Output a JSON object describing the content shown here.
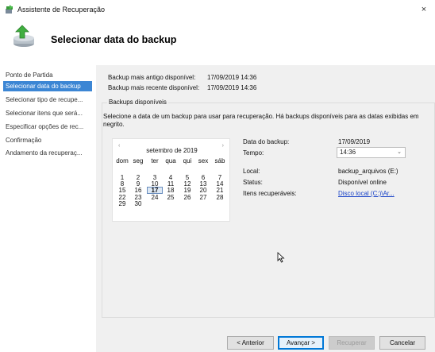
{
  "window": {
    "title": "Assistente de Recuperação",
    "close_glyph": "×"
  },
  "header": {
    "title": "Selecionar data do backup"
  },
  "sidebar": {
    "items": [
      {
        "label": "Ponto de Partida"
      },
      {
        "label": "Selecionar data do backup"
      },
      {
        "label": "Selecionar tipo de recupe..."
      },
      {
        "label": "Selecionar itens que será..."
      },
      {
        "label": "Especificar opções de rec..."
      },
      {
        "label": "Confirmação"
      },
      {
        "label": "Andamento da recuperaç..."
      }
    ],
    "active_index": 1
  },
  "summary": {
    "oldest_label": "Backup mais antigo disponível:",
    "oldest_value": "17/09/2019 14:36",
    "newest_label": "Backup mais recente disponível:",
    "newest_value": "17/09/2019 14:36"
  },
  "available": {
    "legend": "Backups disponíveis",
    "instruction": "Selecione a data de um backup para usar para recuperação. Há backups disponíveis para as datas exibidas em negrito."
  },
  "calendar": {
    "prev_glyph": "‹",
    "next_glyph": "›",
    "month": "setembro de 2019",
    "weekdays": [
      "dom",
      "seg",
      "ter",
      "qua",
      "qui",
      "sex",
      "sáb"
    ],
    "weeks": [
      [
        "1",
        "2",
        "3",
        "4",
        "5",
        "6",
        "7"
      ],
      [
        "8",
        "9",
        "10",
        "11",
        "12",
        "13",
        "14"
      ],
      [
        "15",
        "16",
        "17",
        "18",
        "19",
        "20",
        "21"
      ],
      [
        "22",
        "23",
        "24",
        "25",
        "26",
        "27",
        "28"
      ],
      [
        "29",
        "30",
        "",
        "",
        "",
        "",
        ""
      ]
    ],
    "selected_day": "17"
  },
  "details": {
    "date_label": "Data do backup:",
    "date_value": "17/09/2019",
    "time_label": "Tempo:",
    "time_value": "14:36",
    "location_label": "Local:",
    "location_value": "backup_arquivos (E:)",
    "status_label": "Status:",
    "status_value": "Disponível online",
    "items_label": "Itens recuperáveis:",
    "items_value": "Disco local (C:)\\Ar..."
  },
  "buttons": {
    "back": "< Anterior",
    "next": "Avançar >",
    "recover": "Recuperar",
    "cancel": "Cancelar"
  },
  "colors": {
    "accent": "#3c86d4",
    "link": "#1a44c8",
    "primary_border": "#0078d7"
  }
}
